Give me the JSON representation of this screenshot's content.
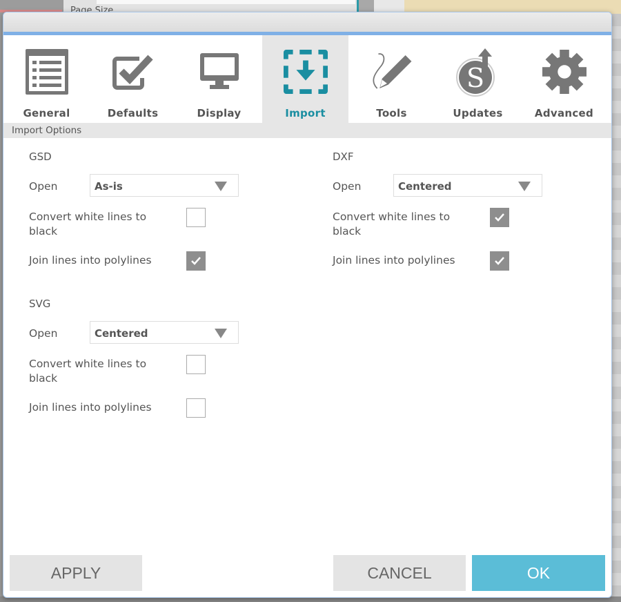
{
  "background": {
    "page_size_label": "Page Size"
  },
  "dialog": {
    "tabs": [
      {
        "id": "general",
        "label": "General",
        "icon": "list-document-icon",
        "active": false
      },
      {
        "id": "defaults",
        "label": "Defaults",
        "icon": "checkbox-check-icon",
        "active": false
      },
      {
        "id": "display",
        "label": "Display",
        "icon": "monitor-icon",
        "active": false
      },
      {
        "id": "import",
        "label": "Import",
        "icon": "import-download-icon",
        "active": true
      },
      {
        "id": "tools",
        "label": "Tools",
        "icon": "pencil-icon",
        "active": false
      },
      {
        "id": "updates",
        "label": "Updates",
        "icon": "silhouette-update-icon",
        "active": false
      },
      {
        "id": "advanced",
        "label": "Advanced",
        "icon": "gear-icon",
        "active": false
      }
    ],
    "section_header": "Import Options",
    "colors": {
      "accent": "#1a8ea1",
      "ok_button": "#5bbdd7",
      "checkbox_checked": "#8e8e8e",
      "titlebar_border": "#7fb0e6"
    },
    "groups": {
      "gsd": {
        "title": "GSD",
        "open_label": "Open",
        "open_value": "As-is",
        "convert_label": "Convert white lines to black",
        "convert_checked": false,
        "join_label": "Join lines into polylines",
        "join_checked": true
      },
      "dxf": {
        "title": "DXF",
        "open_label": "Open",
        "open_value": "Centered",
        "convert_label": "Convert white lines to black",
        "convert_checked": true,
        "join_label": "Join lines into polylines",
        "join_checked": true
      },
      "svg": {
        "title": "SVG",
        "open_label": "Open",
        "open_value": "Centered",
        "convert_label": "Convert white lines to black",
        "convert_checked": false,
        "join_label": "Join lines into polylines",
        "join_checked": false
      }
    },
    "buttons": {
      "apply": "APPLY",
      "cancel": "CANCEL",
      "ok": "OK"
    }
  }
}
